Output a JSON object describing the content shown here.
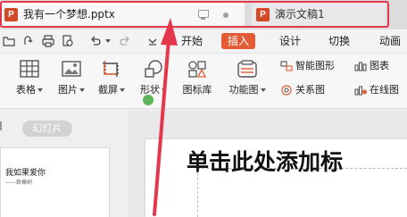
{
  "tabs": [
    {
      "badge": "P",
      "title": "我有一个梦想.pptx",
      "active": true
    },
    {
      "badge": "P",
      "title": "演示文稿1",
      "active": false
    }
  ],
  "menu": {
    "items": [
      "开始",
      "插入",
      "设计",
      "切换",
      "动画"
    ],
    "selected": "插入"
  },
  "ribbon": {
    "table": "表格",
    "picture": "图片",
    "screenshot": "截屏",
    "shape": "形状",
    "icon_library": "图标库",
    "function_chart": "功能图",
    "smart_graphic": "智能图形",
    "chart": "图表",
    "relation_chart": "关系图",
    "online_chart": "在线图"
  },
  "left_panel": {
    "slides_tab": "幻灯片",
    "thumb_title": "我如果爱你",
    "thumb_subtitle": "——致橡树"
  },
  "slide": {
    "heading": "单击此处添加标"
  },
  "colors": {
    "accent": "#e25b34",
    "highlight_border": "#e5364b",
    "ppt_badge": "#d24a26"
  }
}
